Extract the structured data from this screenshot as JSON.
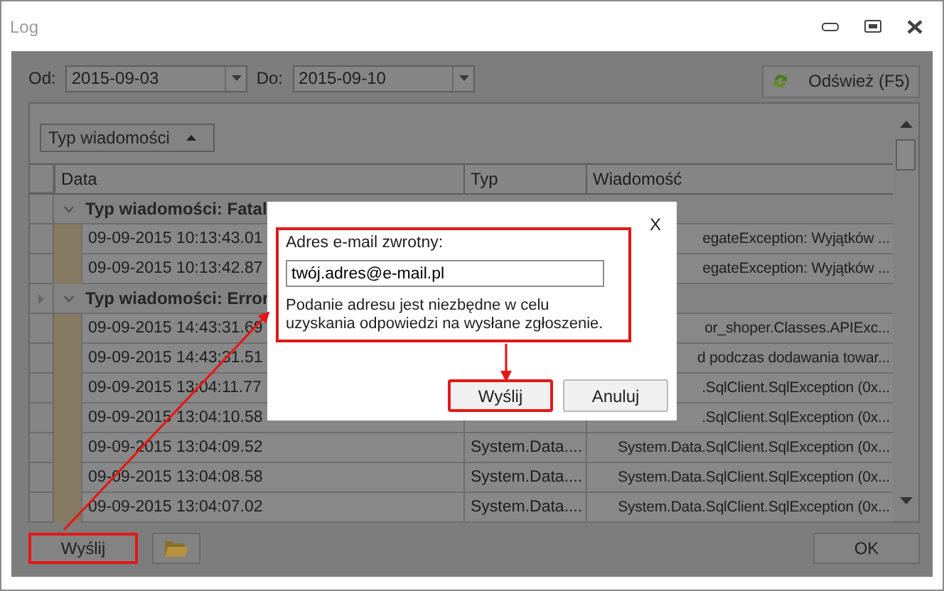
{
  "window": {
    "title": "Log"
  },
  "filters": {
    "from_label": "Od:",
    "from_value": "2015-09-03",
    "to_label": "Do:",
    "to_value": "2015-09-10",
    "refresh_button": "Odśwież (F5)"
  },
  "grid": {
    "group_by_button": "Typ wiadomości",
    "columns": [
      "Data",
      "Typ",
      "Wiadomość"
    ],
    "groups": [
      {
        "label": "Typ wiadomości: Fatal",
        "expanded": true,
        "selected": false,
        "rows": [
          {
            "date": "09-09-2015 10:13:43.01",
            "message": "egateException: Wyjątków ..."
          },
          {
            "date": "09-09-2015 10:13:42.87",
            "message": "egateException: Wyjątków ..."
          }
        ]
      },
      {
        "label": "Typ wiadomości: Error",
        "expanded": true,
        "selected": true,
        "rows": [
          {
            "date": "09-09-2015 14:43:31.69",
            "message": "or_shoper.Classes.APIExc..."
          },
          {
            "date": "09-09-2015 14:43:31.51",
            "message": "d podczas dodawania towar..."
          },
          {
            "date": "09-09-2015 13:04:11.77",
            "message": ".SqlClient.SqlException (0x..."
          },
          {
            "date": "09-09-2015 13:04:10.58",
            "message": ".SqlClient.SqlException (0x..."
          },
          {
            "date": "09-09-2015 13:04:09.52",
            "type": "System.Data....",
            "message": "System.Data.SqlClient.SqlException (0x..."
          },
          {
            "date": "09-09-2015 13:04:08.58",
            "type": "System.Data....",
            "message": "System.Data.SqlClient.SqlException (0x..."
          },
          {
            "date": "09-09-2015 13:04:07.02",
            "type": "System.Data....",
            "message": "System.Data.SqlClient.SqlException (0x..."
          }
        ]
      }
    ]
  },
  "footer": {
    "send_button": "Wyślij",
    "ok_button": "OK"
  },
  "dialog": {
    "close": "X",
    "label": "Adres e-mail zwrotny:",
    "email_value": "twój.adres@e-mail.pl",
    "note": "Podanie adresu jest niezbędne w celu uzyskania odpowiedzi na wysłane zgłoszenie.",
    "send_button": "Wyślij",
    "cancel_button": "Anuluj"
  }
}
